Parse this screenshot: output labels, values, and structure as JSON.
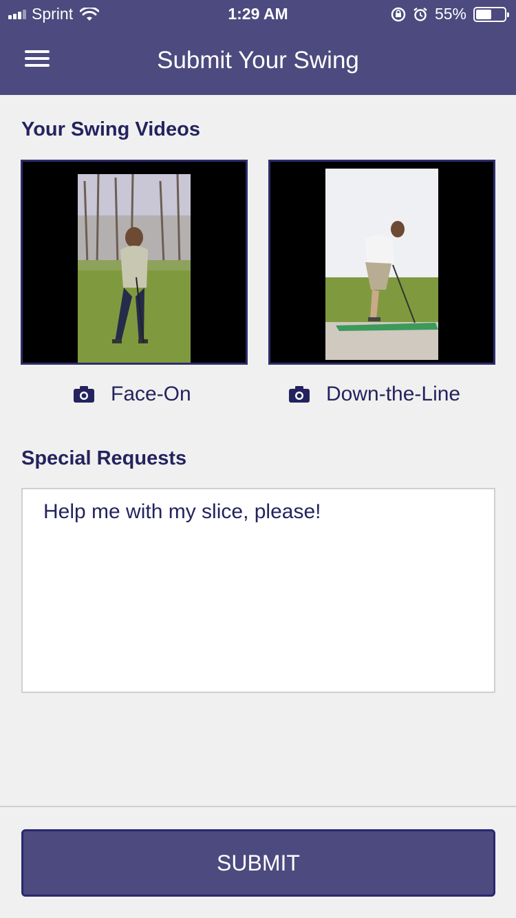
{
  "status_bar": {
    "carrier": "Sprint",
    "time": "1:29 AM",
    "battery": "55%",
    "battery_level": 0.55,
    "icons": [
      "signal-icon",
      "wifi-icon",
      "rotation-lock-icon",
      "alarm-icon",
      "battery-icon"
    ]
  },
  "header": {
    "title": "Submit Your Swing",
    "menu_icon": "hamburger-menu-icon"
  },
  "videos": {
    "section_title": "Your Swing Videos",
    "items": [
      {
        "label": "Face-On",
        "icon": "camera-icon"
      },
      {
        "label": "Down-the-Line",
        "icon": "camera-icon"
      }
    ]
  },
  "requests": {
    "section_title": "Special Requests",
    "value": "Help me with my slice, please!"
  },
  "footer": {
    "submit_label": "SUBMIT"
  },
  "colors": {
    "brand": "#4c4a7e",
    "text": "#24235e",
    "background": "#f0f0f0"
  }
}
